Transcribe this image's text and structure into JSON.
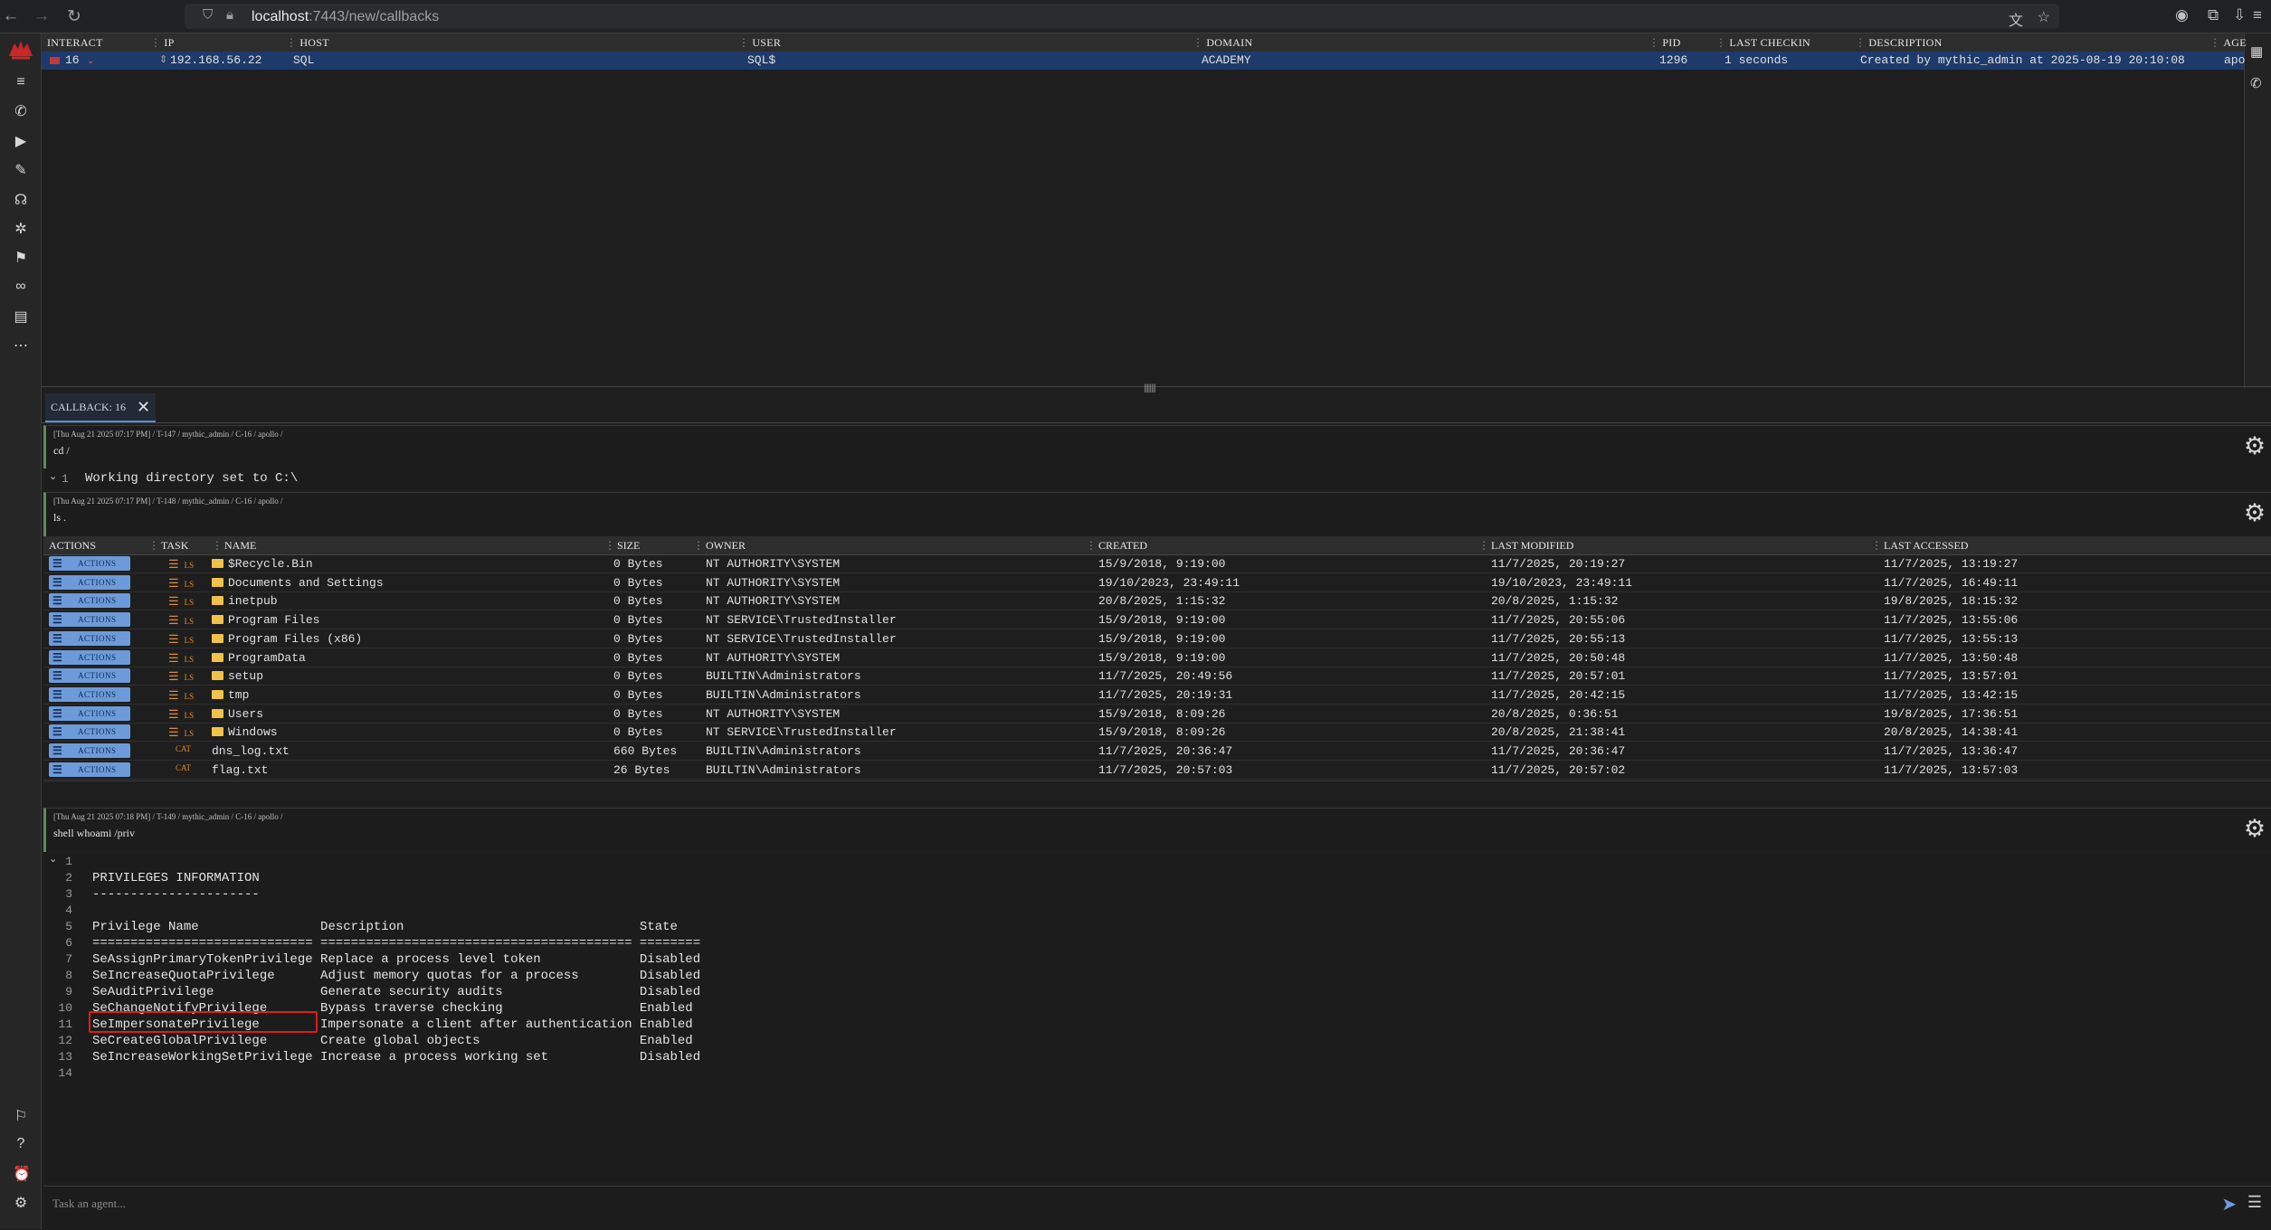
{
  "browser": {
    "url_host": "localhost",
    "url_path": ":7443/new/callbacks"
  },
  "callbacks": {
    "headers": [
      "INTERACT",
      "IP",
      "HOST",
      "USER",
      "DOMAIN",
      "PID",
      "LAST CHECKIN",
      "DESCRIPTION",
      "AGE"
    ],
    "row": {
      "interact": "16",
      "ip": "192.168.56.22",
      "host": "SQL",
      "user": "SQL$",
      "domain": "ACADEMY",
      "pid": "1296",
      "last_checkin": "1 seconds",
      "description": "Created by mythic_admin at 2025-08-19 20:10:08",
      "agent": "apo"
    }
  },
  "tab": {
    "label": "CALLBACK: 16"
  },
  "tasks": [
    {
      "meta": "[Thu Aug 21 2025 07:17 PM] / T-147 / mythic_admin / C-16 / apollo /",
      "command": "cd /",
      "output_line_no": "1",
      "output": "Working directory set to C:\\"
    },
    {
      "meta": "[Thu Aug 21 2025 07:17 PM] / T-148 / mythic_admin / C-16 / apollo /",
      "command": "ls ."
    },
    {
      "meta": "[Thu Aug 21 2025 07:18 PM] / T-149 / mythic_admin / C-16 / apollo /",
      "command": "shell whoami /priv"
    }
  ],
  "ls_table": {
    "headers": [
      "ACTIONS",
      "TASK",
      "NAME",
      "SIZE",
      "OWNER",
      "CREATED",
      "LAST MODIFIED",
      "LAST ACCESSED"
    ],
    "action_label": "ACTIONS",
    "rows": [
      {
        "task": "LS",
        "name": "$Recycle.Bin",
        "folder": true,
        "size": "0 Bytes",
        "owner": "NT AUTHORITY\\SYSTEM",
        "created": "15/9/2018, 9:19:00",
        "modified": "11/7/2025, 20:19:27",
        "accessed": "11/7/2025, 13:19:27"
      },
      {
        "task": "LS",
        "name": "Documents and Settings",
        "folder": true,
        "size": "0 Bytes",
        "owner": "NT AUTHORITY\\SYSTEM",
        "created": "19/10/2023, 23:49:11",
        "modified": "19/10/2023, 23:49:11",
        "accessed": "11/7/2025, 16:49:11"
      },
      {
        "task": "LS",
        "name": "inetpub",
        "folder": true,
        "size": "0 Bytes",
        "owner": "NT AUTHORITY\\SYSTEM",
        "created": "20/8/2025, 1:15:32",
        "modified": "20/8/2025, 1:15:32",
        "accessed": "19/8/2025, 18:15:32"
      },
      {
        "task": "LS",
        "name": "Program Files",
        "folder": true,
        "size": "0 Bytes",
        "owner": "NT SERVICE\\TrustedInstaller",
        "created": "15/9/2018, 9:19:00",
        "modified": "11/7/2025, 20:55:06",
        "accessed": "11/7/2025, 13:55:06"
      },
      {
        "task": "LS",
        "name": "Program Files (x86)",
        "folder": true,
        "size": "0 Bytes",
        "owner": "NT SERVICE\\TrustedInstaller",
        "created": "15/9/2018, 9:19:00",
        "modified": "11/7/2025, 20:55:13",
        "accessed": "11/7/2025, 13:55:13"
      },
      {
        "task": "LS",
        "name": "ProgramData",
        "folder": true,
        "size": "0 Bytes",
        "owner": "NT AUTHORITY\\SYSTEM",
        "created": "15/9/2018, 9:19:00",
        "modified": "11/7/2025, 20:50:48",
        "accessed": "11/7/2025, 13:50:48"
      },
      {
        "task": "LS",
        "name": "setup",
        "folder": true,
        "size": "0 Bytes",
        "owner": "BUILTIN\\Administrators",
        "created": "11/7/2025, 20:49:56",
        "modified": "11/7/2025, 20:57:01",
        "accessed": "11/7/2025, 13:57:01"
      },
      {
        "task": "LS",
        "name": "tmp",
        "folder": true,
        "size": "0 Bytes",
        "owner": "BUILTIN\\Administrators",
        "created": "11/7/2025, 20:19:31",
        "modified": "11/7/2025, 20:42:15",
        "accessed": "11/7/2025, 13:42:15"
      },
      {
        "task": "LS",
        "name": "Users",
        "folder": true,
        "size": "0 Bytes",
        "owner": "NT AUTHORITY\\SYSTEM",
        "created": "15/9/2018, 8:09:26",
        "modified": "20/8/2025, 0:36:51",
        "accessed": "19/8/2025, 17:36:51"
      },
      {
        "task": "LS",
        "name": "Windows",
        "folder": true,
        "size": "0 Bytes",
        "owner": "NT SERVICE\\TrustedInstaller",
        "created": "15/9/2018, 8:09:26",
        "modified": "20/8/2025, 21:38:41",
        "accessed": "20/8/2025, 14:38:41"
      },
      {
        "task": "CAT",
        "name": "dns_log.txt",
        "folder": false,
        "size": "660 Bytes",
        "owner": "BUILTIN\\Administrators",
        "created": "11/7/2025, 20:36:47",
        "modified": "11/7/2025, 20:36:47",
        "accessed": "11/7/2025, 13:36:47"
      },
      {
        "task": "CAT",
        "name": "flag.txt",
        "folder": false,
        "size": "26 Bytes",
        "owner": "BUILTIN\\Administrators",
        "created": "11/7/2025, 20:57:03",
        "modified": "11/7/2025, 20:57:02",
        "accessed": "11/7/2025, 13:57:03"
      }
    ]
  },
  "whoami_output": [
    {
      "n": "1",
      "t": ""
    },
    {
      "n": "2",
      "t": "PRIVILEGES INFORMATION"
    },
    {
      "n": "3",
      "t": "----------------------"
    },
    {
      "n": "4",
      "t": ""
    },
    {
      "n": "5",
      "t": "Privilege Name                Description                               State"
    },
    {
      "n": "6",
      "t": "============================= ========================================= ========"
    },
    {
      "n": "7",
      "t": "SeAssignPrimaryTokenPrivilege Replace a process level token             Disabled"
    },
    {
      "n": "8",
      "t": "SeIncreaseQuotaPrivilege      Adjust memory quotas for a process        Disabled"
    },
    {
      "n": "9",
      "t": "SeAuditPrivilege              Generate security audits                  Disabled"
    },
    {
      "n": "10",
      "t": "SeChangeNotifyPrivilege       Bypass traverse checking                  Enabled"
    },
    {
      "n": "11",
      "t": "SeImpersonatePrivilege        Impersonate a client after authentication Enabled"
    },
    {
      "n": "12",
      "t": "SeCreateGlobalPrivilege       Create global objects                     Enabled"
    },
    {
      "n": "13",
      "t": "SeIncreaseWorkingSetPrivilege Increase a process working set            Disabled"
    },
    {
      "n": "14",
      "t": ""
    }
  ],
  "task_input": {
    "placeholder": "Task an agent..."
  },
  "colors": {
    "selected_row": "#1d3a6b",
    "action_button": "#6d9bd9",
    "task_label": "#e08a2e",
    "folder": "#f0c14b",
    "highlight_box": "#e01b1b"
  }
}
